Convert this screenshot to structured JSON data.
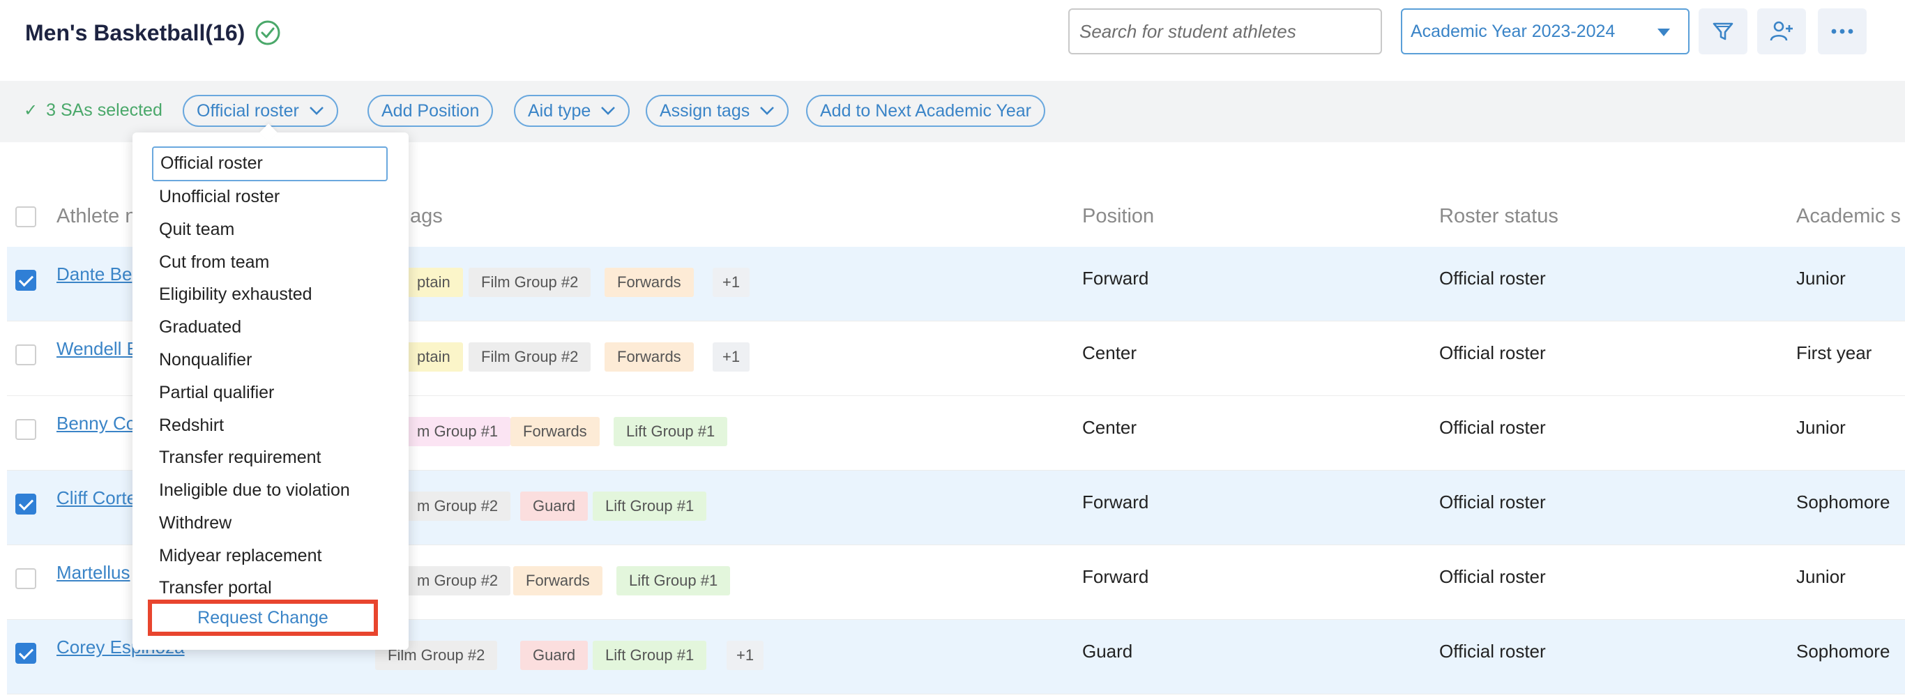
{
  "header": {
    "title": "Men's Basketball(16)",
    "search_placeholder": "Search for student athletes",
    "year_select_value": "Academic Year 2023-2024"
  },
  "action_bar": {
    "selected_count": "3 SAs selected",
    "buttons": {
      "official_roster": "Official roster",
      "add_position": "Add Position",
      "aid_type": "Aid type",
      "assign_tags": "Assign tags",
      "add_next_year": "Add to Next Academic Year"
    }
  },
  "dropdown": {
    "current": "Official roster",
    "items": [
      "Unofficial roster",
      "Quit team",
      "Cut from team",
      "Eligibility exhausted",
      "Graduated",
      "Nonqualifier",
      "Partial qualifier",
      "Redshirt",
      "Transfer requirement",
      "Ineligible due to violation",
      "Withdrew",
      "Midyear replacement",
      "Transfer portal"
    ],
    "request_change": "Request Change"
  },
  "table": {
    "headers": {
      "athlete": "Athlete n",
      "tags": "ags",
      "position": "Position",
      "roster_status": "Roster status",
      "academic": "Academic s"
    },
    "rows": [
      {
        "name": "Dante Be",
        "tags": [
          "ptain",
          "Film Group #2",
          "Forwards",
          "+1"
        ],
        "position": "Forward",
        "roster_status": "Official roster",
        "academic": "Junior",
        "selected": true
      },
      {
        "name": "Wendell E",
        "tags": [
          "ptain",
          "Film Group #2",
          "Forwards",
          "+1"
        ],
        "position": "Center",
        "roster_status": "Official roster",
        "academic": "First year",
        "selected": false
      },
      {
        "name": "Benny Co",
        "tags": [
          "m Group #1",
          "Forwards",
          "Lift Group #1"
        ],
        "position": "Center",
        "roster_status": "Official roster",
        "academic": "Junior",
        "selected": false
      },
      {
        "name": "Cliff Corte",
        "tags": [
          "m Group #2",
          "Guard",
          "Lift Group #1"
        ],
        "position": "Forward",
        "roster_status": "Official roster",
        "academic": "Sophomore",
        "selected": true
      },
      {
        "name": "Martellus",
        "tags": [
          "m Group #2",
          "Forwards",
          "Lift Group #1"
        ],
        "position": "Forward",
        "roster_status": "Official roster",
        "academic": "Junior",
        "selected": false
      },
      {
        "name": "Corey Espinoza",
        "tags": [
          "Film Group #2",
          "Guard",
          "Lift Group #1",
          "+1"
        ],
        "position": "Guard",
        "roster_status": "Official roster",
        "academic": "Sophomore",
        "selected": true
      }
    ]
  },
  "colors": {
    "accent": "#3a84c7",
    "success": "#4aa86a",
    "highlight_box": "#e8452e"
  }
}
